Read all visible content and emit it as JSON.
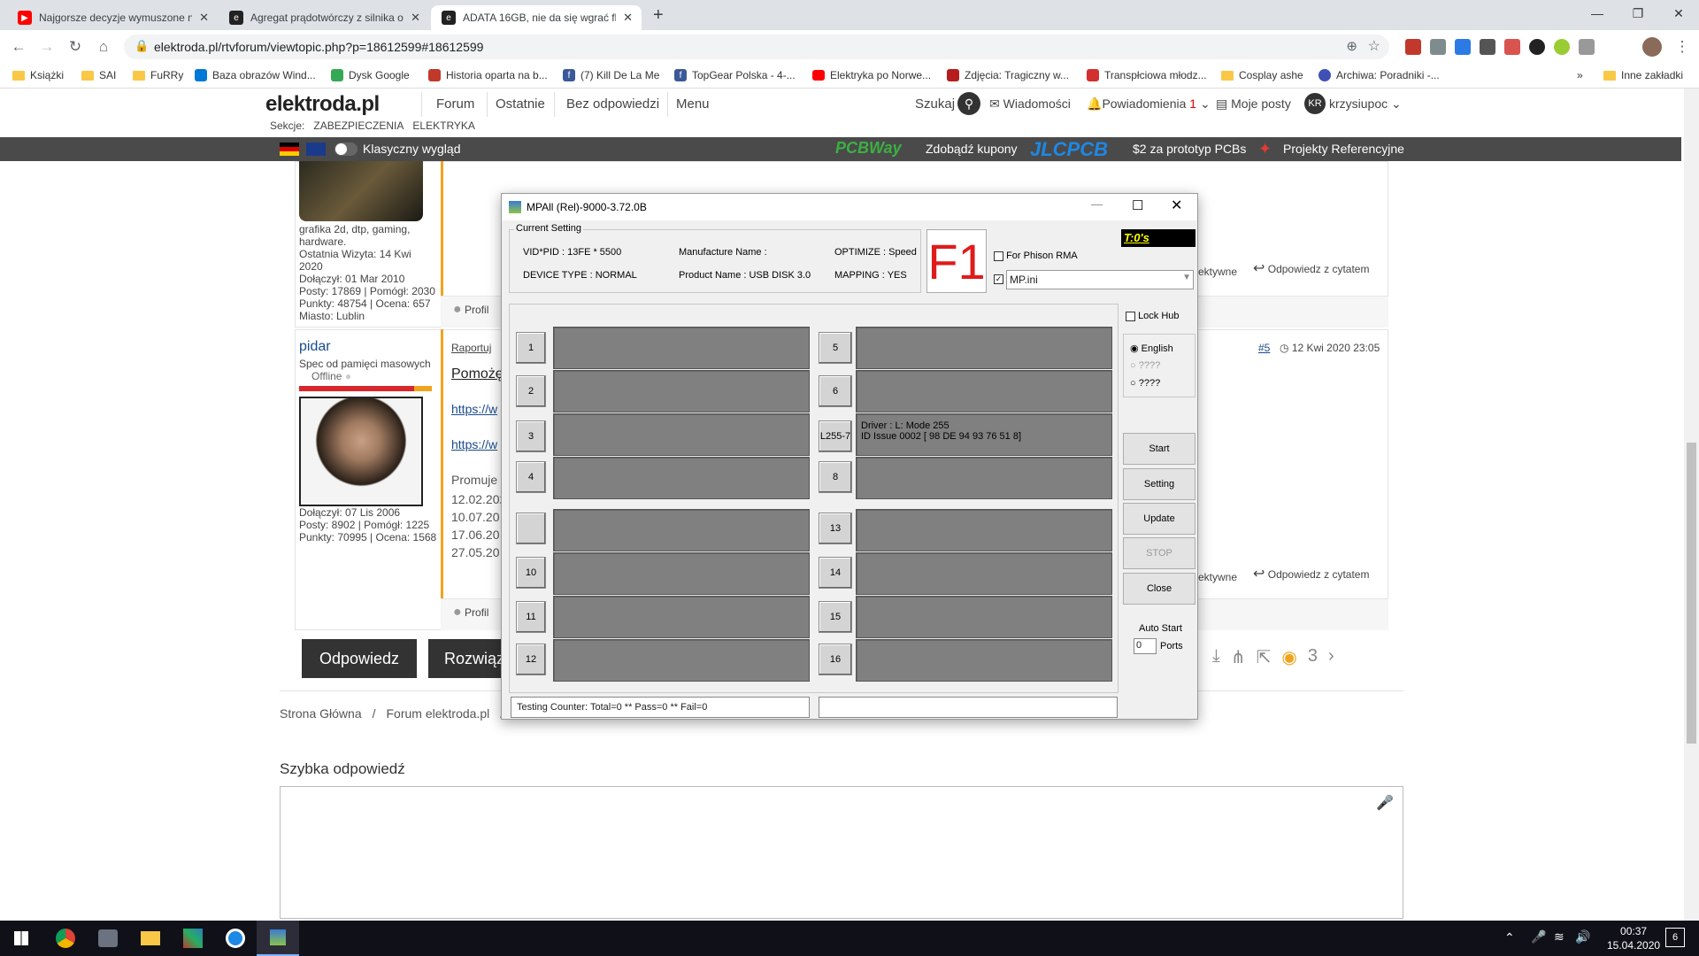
{
  "browser": {
    "tabs": [
      {
        "title": "Najgorsze decyzje wymuszone na",
        "icon": "youtube-icon",
        "color": "#ff0000"
      },
      {
        "title": "Agregat prądotwórczy z silnika od",
        "icon": "elektroda-icon",
        "color": "#222222"
      },
      {
        "title": "ADATA 16GB, nie da się wgrać fla",
        "icon": "elektroda-icon",
        "color": "#222222",
        "active": true
      }
    ],
    "url": "elektroda.pl/rtvforum/viewtopic.php?p=18612599#18612599",
    "bookmarks": [
      {
        "label": "Książki",
        "icon": "folder-icon"
      },
      {
        "label": "SAI",
        "icon": "folder-icon"
      },
      {
        "label": "FuRRy",
        "icon": "folder-icon"
      },
      {
        "label": "Baza obrazów Wind...",
        "icon": "windows-icon"
      },
      {
        "label": "Dysk Google",
        "icon": "drive-icon"
      },
      {
        "label": "Historia oparta na b...",
        "icon": "history-icon"
      },
      {
        "label": "(7) Kill De La Me",
        "icon": "facebook-icon"
      },
      {
        "label": "TopGear Polska - 4-...",
        "icon": "facebook-icon"
      },
      {
        "label": "Elektryka po Norwe...",
        "icon": "youtube-icon"
      },
      {
        "label": "Zdjęcia: Tragiczny w...",
        "icon": "news-icon"
      },
      {
        "label": "Transpłciowa młodz...",
        "icon": "news-icon"
      },
      {
        "label": "Cosplay ashe",
        "icon": "folder-icon"
      },
      {
        "label": "Archiwa: Poradniki -...",
        "icon": "archive-icon"
      }
    ],
    "bookmarks_more": "»",
    "other_bookmarks": "Inne zakładki"
  },
  "site": {
    "logo": "elektroda.pl",
    "nav": [
      "Forum",
      "Ostatnie",
      "Bez odpowiedzi",
      "Menu"
    ],
    "search": "Szukaj",
    "messages": "Wiadomości",
    "notifications": "Powiadomienia",
    "notifications_count": "1",
    "my_posts": "Moje posty",
    "avatar_initials": "KR",
    "username": "krzysiupoc",
    "sections_label": "Sekcje:",
    "sections": [
      "ZABEZPIECZENIA",
      "ELEKTRYKA"
    ],
    "classic_view": "Klasyczny wygląd",
    "promo": [
      {
        "brand": "PCBWay",
        "text": "Zdobądź kupony"
      },
      {
        "brand": "JLCPCB",
        "text": "$2 za prototyp PCBs"
      },
      {
        "brand": "",
        "text": "Projekty Referencyjne"
      }
    ]
  },
  "posts": [
    {
      "user_info": [
        "grafika 2d, dtp, gaming,",
        "hardware.",
        "Ostatnia Wizyta: 14 Kwi",
        "2020",
        "Dołączył: 01 Mar 2010",
        "Posty: 17869 | Pomógł: 2030",
        "Punkty: 48754 | Ocena: 657",
        "Miasto: Lublin"
      ],
      "profile": "Profil",
      "helpful_partial": "ektywne",
      "quote_reply": "Odpowiedz z cytatem"
    },
    {
      "username": "pidar",
      "rank": "Spec od pamięci masowych",
      "status": "Offline",
      "user_info": [
        "Dołączył: 07 Lis 2006",
        "Posty: 8902 | Pomógł: 1225",
        "Punkty: 70995 | Ocena: 1568"
      ],
      "report": "Raportuj",
      "title_partial": "Pomożę",
      "links": [
        "https://w",
        "https://w"
      ],
      "promo_partial": "Promuje t",
      "dates": [
        "12.02.202",
        "10.07.20",
        "17.06.20",
        "27.05.20"
      ],
      "post_no": "#5",
      "date": "12 Kwi 2020 23:05",
      "profile": "Profil",
      "helpful_partial": "ektywne",
      "quote_reply": "Odpowiedz z cytatem"
    }
  ],
  "actions": {
    "reply": "Odpowiedz",
    "solve_partial": "Rozwiąz",
    "views": "3"
  },
  "breadcrumb": [
    "Strona Główna",
    "/",
    "Forum elektroda.pl",
    "/"
  ],
  "quick_reply": {
    "title": "Szybka odpowiedź"
  },
  "dialog": {
    "title": "MPAll (Rel)-9000-3.72.0B",
    "current_setting": "Current Setting",
    "vid_pid": "VID*PID : 13FE * 5500",
    "manufacture": "Manufacture Name :",
    "optimize": "OPTIMIZE : Speed",
    "device_type": "DEVICE TYPE : NORMAL",
    "product": "Product Name : USB DISK 3.0",
    "mapping": "MAPPING : YES",
    "big_label": "F1",
    "timer": "T:0's",
    "for_phison": "For Phison RMA",
    "ini_file": "MP.ini",
    "lock_hub": "Lock Hub",
    "languages": [
      "English",
      "????",
      "????"
    ],
    "ports_left": [
      "1",
      "2",
      "3",
      "4",
      "",
      "10",
      "11",
      "12"
    ],
    "ports_right": [
      "5",
      "6",
      "L255-7",
      "8",
      "13",
      "14",
      "15",
      "16"
    ],
    "driver_line1": "Driver : L: Mode 255",
    "driver_line2": "ID Issue 0002 [ 98 DE 94 93 76 51 8]",
    "buttons": [
      "Start",
      "Setting",
      "Update",
      "STOP",
      "Close"
    ],
    "auto_start": "Auto Start",
    "ports_value": "0",
    "ports_label": "Ports",
    "counter": "Testing Counter: Total=0 ** Pass=0 ** Fail=0"
  },
  "taskbar": {
    "time": "00:37",
    "date": "15.04.2020",
    "notification_count": "6"
  }
}
